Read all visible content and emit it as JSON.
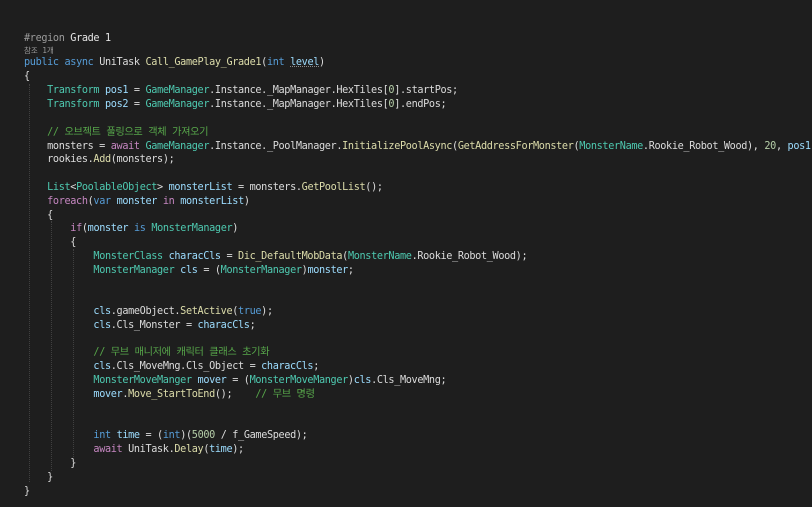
{
  "codelens": "참조 1개",
  "lines": [
    [
      [
        "#region ",
        "directive"
      ],
      [
        "Grade 1",
        "regionname"
      ]
    ],
    [
      [
        "public",
        "keyword"
      ],
      [
        " ",
        "plain"
      ],
      [
        "async",
        "keyword"
      ],
      [
        " UniTask ",
        "plain"
      ],
      [
        "Call_GamePlay_Grade1",
        "method"
      ],
      [
        "(",
        "punct"
      ],
      [
        "int",
        "keyword"
      ],
      [
        " ",
        "plain"
      ],
      [
        "level",
        "param",
        "squiggle"
      ],
      [
        ")",
        "punct"
      ]
    ],
    [
      [
        "{",
        "punct"
      ]
    ],
    [
      [
        "    ",
        "plain"
      ],
      [
        "Transform",
        "type"
      ],
      [
        " ",
        "plain"
      ],
      [
        "pos1",
        "local"
      ],
      [
        " = ",
        "punct"
      ],
      [
        "GameManager",
        "type"
      ],
      [
        ".Instance._MapManager.HexTiles[",
        "plain"
      ],
      [
        "0",
        "number"
      ],
      [
        "].startPos;",
        "plain"
      ]
    ],
    [
      [
        "    ",
        "plain"
      ],
      [
        "Transform",
        "type"
      ],
      [
        " ",
        "plain"
      ],
      [
        "pos2",
        "local"
      ],
      [
        " = ",
        "punct"
      ],
      [
        "GameManager",
        "type"
      ],
      [
        ".Instance._MapManager.HexTiles[",
        "plain"
      ],
      [
        "0",
        "number"
      ],
      [
        "].endPos;",
        "plain"
      ]
    ],
    [],
    [
      [
        "    ",
        "plain"
      ],
      [
        "// 오브젝트 풀링으로 객체 가져오기",
        "comment"
      ]
    ],
    [
      [
        "    monsters = ",
        "plain"
      ],
      [
        "await",
        "control"
      ],
      [
        " ",
        "plain"
      ],
      [
        "GameManager",
        "type"
      ],
      [
        ".Instance._PoolManager.",
        "plain"
      ],
      [
        "InitializePoolAsync",
        "method"
      ],
      [
        "(",
        "punct"
      ],
      [
        "GetAddressForMonster",
        "method"
      ],
      [
        "(",
        "punct"
      ],
      [
        "MonsterName",
        "type"
      ],
      [
        ".Rookie_Robot_Wood), ",
        "plain"
      ],
      [
        "20",
        "number"
      ],
      [
        ", ",
        "plain"
      ],
      [
        "pos1",
        "local"
      ],
      [
        ");",
        "punct"
      ]
    ],
    [
      [
        "    rookies.",
        "plain"
      ],
      [
        "Add",
        "method"
      ],
      [
        "(monsters);",
        "plain"
      ]
    ],
    [],
    [
      [
        "    ",
        "plain"
      ],
      [
        "List",
        "type"
      ],
      [
        "<",
        "punct"
      ],
      [
        "PoolableObject",
        "type"
      ],
      [
        "> ",
        "punct"
      ],
      [
        "monsterList",
        "local"
      ],
      [
        " = monsters.",
        "plain"
      ],
      [
        "GetPoolList",
        "method"
      ],
      [
        "();",
        "punct"
      ]
    ],
    [
      [
        "    ",
        "plain"
      ],
      [
        "foreach",
        "control"
      ],
      [
        "(",
        "punct"
      ],
      [
        "var",
        "keyword"
      ],
      [
        " ",
        "plain"
      ],
      [
        "monster",
        "local"
      ],
      [
        " ",
        "plain"
      ],
      [
        "in",
        "control"
      ],
      [
        " ",
        "plain"
      ],
      [
        "monsterList",
        "local"
      ],
      [
        ")",
        "punct"
      ]
    ],
    [
      [
        "    {",
        "punct"
      ]
    ],
    [
      [
        "        ",
        "plain"
      ],
      [
        "if",
        "control"
      ],
      [
        "(",
        "punct"
      ],
      [
        "monster",
        "local"
      ],
      [
        " ",
        "plain"
      ],
      [
        "is",
        "keyword"
      ],
      [
        " ",
        "plain"
      ],
      [
        "MonsterManager",
        "type"
      ],
      [
        ")",
        "punct"
      ]
    ],
    [
      [
        "        {",
        "punct"
      ]
    ],
    [
      [
        "            ",
        "plain"
      ],
      [
        "MonsterClass",
        "type"
      ],
      [
        " ",
        "plain"
      ],
      [
        "characCls",
        "local"
      ],
      [
        " = ",
        "punct"
      ],
      [
        "Dic_DefaultMobData",
        "method"
      ],
      [
        "(",
        "punct"
      ],
      [
        "MonsterName",
        "type"
      ],
      [
        ".Rookie_Robot_Wood);",
        "plain"
      ]
    ],
    [
      [
        "            ",
        "plain"
      ],
      [
        "MonsterManager",
        "type"
      ],
      [
        " ",
        "plain"
      ],
      [
        "cls",
        "local"
      ],
      [
        " = (",
        "punct"
      ],
      [
        "MonsterManager",
        "type"
      ],
      [
        ")",
        "punct"
      ],
      [
        "monster",
        "local"
      ],
      [
        ";",
        "punct"
      ]
    ],
    [],
    [],
    [
      [
        "            ",
        "plain"
      ],
      [
        "cls",
        "local"
      ],
      [
        ".gameObject.",
        "plain"
      ],
      [
        "SetActive",
        "method"
      ],
      [
        "(",
        "punct"
      ],
      [
        "true",
        "keyword"
      ],
      [
        ");",
        "punct"
      ]
    ],
    [
      [
        "            ",
        "plain"
      ],
      [
        "cls",
        "local"
      ],
      [
        ".Cls_Monster = ",
        "plain"
      ],
      [
        "characCls",
        "local"
      ],
      [
        ";",
        "punct"
      ]
    ],
    [],
    [
      [
        "            ",
        "plain"
      ],
      [
        "// 무브 매니저에 캐릭터 클래스 초기화",
        "comment"
      ]
    ],
    [
      [
        "            ",
        "plain"
      ],
      [
        "cls",
        "local"
      ],
      [
        ".Cls_MoveMng.Cls_Object = ",
        "plain"
      ],
      [
        "characCls",
        "local"
      ],
      [
        ";",
        "punct"
      ]
    ],
    [
      [
        "            ",
        "plain"
      ],
      [
        "MonsterMoveManger",
        "type"
      ],
      [
        " ",
        "plain"
      ],
      [
        "mover",
        "local"
      ],
      [
        " = (",
        "punct"
      ],
      [
        "MonsterMoveManger",
        "type"
      ],
      [
        ")",
        "punct"
      ],
      [
        "cls",
        "local"
      ],
      [
        ".Cls_MoveMng;",
        "plain"
      ]
    ],
    [
      [
        "            ",
        "plain"
      ],
      [
        "mover",
        "local"
      ],
      [
        ".",
        "plain"
      ],
      [
        "Move_StartToEnd",
        "method"
      ],
      [
        "();    ",
        "punct"
      ],
      [
        "// 무브 명령",
        "comment"
      ]
    ],
    [],
    [],
    [
      [
        "            ",
        "plain"
      ],
      [
        "int",
        "keyword"
      ],
      [
        " ",
        "plain"
      ],
      [
        "time",
        "local"
      ],
      [
        " = (",
        "punct"
      ],
      [
        "int",
        "keyword"
      ],
      [
        ")(",
        "punct"
      ],
      [
        "5000",
        "number"
      ],
      [
        " / f_GameSpeed);",
        "plain"
      ]
    ],
    [
      [
        "            ",
        "plain"
      ],
      [
        "await",
        "control"
      ],
      [
        " UniTask.",
        "plain"
      ],
      [
        "Delay",
        "method"
      ],
      [
        "(",
        "punct"
      ],
      [
        "time",
        "local"
      ],
      [
        ");",
        "punct"
      ]
    ],
    [
      [
        "        }",
        "punct"
      ]
    ],
    [
      [
        "    }",
        "punct"
      ]
    ],
    [
      [
        "}",
        "punct"
      ]
    ]
  ]
}
